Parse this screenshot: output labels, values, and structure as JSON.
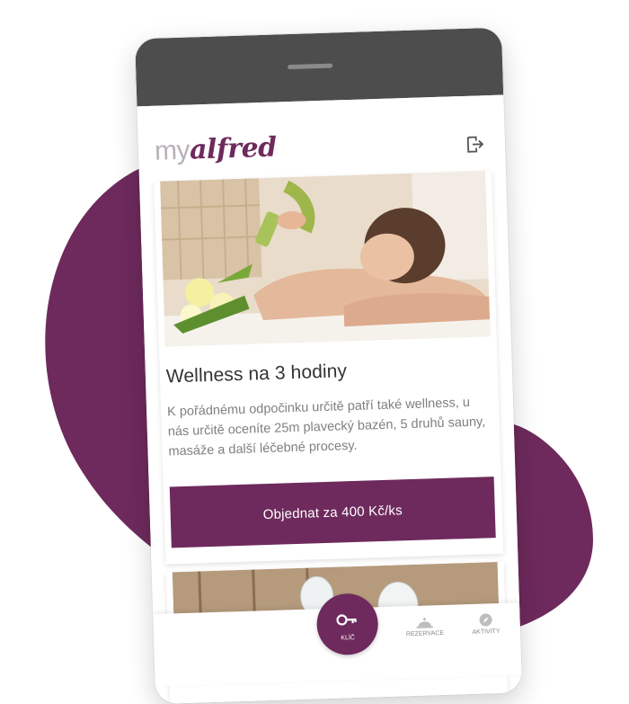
{
  "app": {
    "logo_my": "my",
    "logo_alfred": "alfred",
    "brand_color": "#6e2a5d"
  },
  "header": {
    "logout_icon": "logout-icon"
  },
  "offer": {
    "title": "Wellness na 3 hodiny",
    "description": "K pořádnému odpočinku určitě patří také wellness, u nás určitě oceníte 25m plavecký bazén, 5 druhů sauny, masáže a další léčebné procesy.",
    "order_button": "Objednat za 400 Kč/ks"
  },
  "bottom_nav": {
    "active_icon": "key-icon",
    "active_label": "KLÍČ",
    "reservations_icon": "bell-icon",
    "reservations_label": "REZERVACE",
    "activities_icon": "compass-icon",
    "activities_label": "AKTIVITY"
  }
}
